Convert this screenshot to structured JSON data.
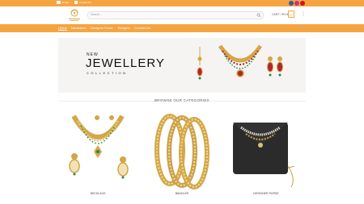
{
  "topbar": {
    "email_label": "Email",
    "phone_label": "Contact Us",
    "social": [
      {
        "name": "facebook-icon",
        "color": "#3b5998"
      },
      {
        "name": "instagram-icon",
        "color": "#c13584"
      },
      {
        "name": "youtube-icon",
        "color": "#cc181e"
      }
    ]
  },
  "header": {
    "search_placeholder": "Search...",
    "cart_label": "CART / ₹0.00",
    "cart_count": "0"
  },
  "nav": {
    "items": [
      "Home",
      "Necklaces",
      "Designer Purse",
      "Bangles",
      "Contact Us"
    ]
  },
  "banner": {
    "line1": "NEW",
    "line2": "JEWELLERY",
    "line3": "COLLECTION"
  },
  "section": {
    "title": "BROWSE OUR CATEGORIES"
  },
  "categories": [
    {
      "label": "NECKLACE"
    },
    {
      "label": "BANGLES"
    },
    {
      "label": "DESIGNER PURSE"
    }
  ],
  "colors": {
    "accent": "#f5a441",
    "gold": "#d4a646",
    "emerald": "#1f8a4c"
  }
}
